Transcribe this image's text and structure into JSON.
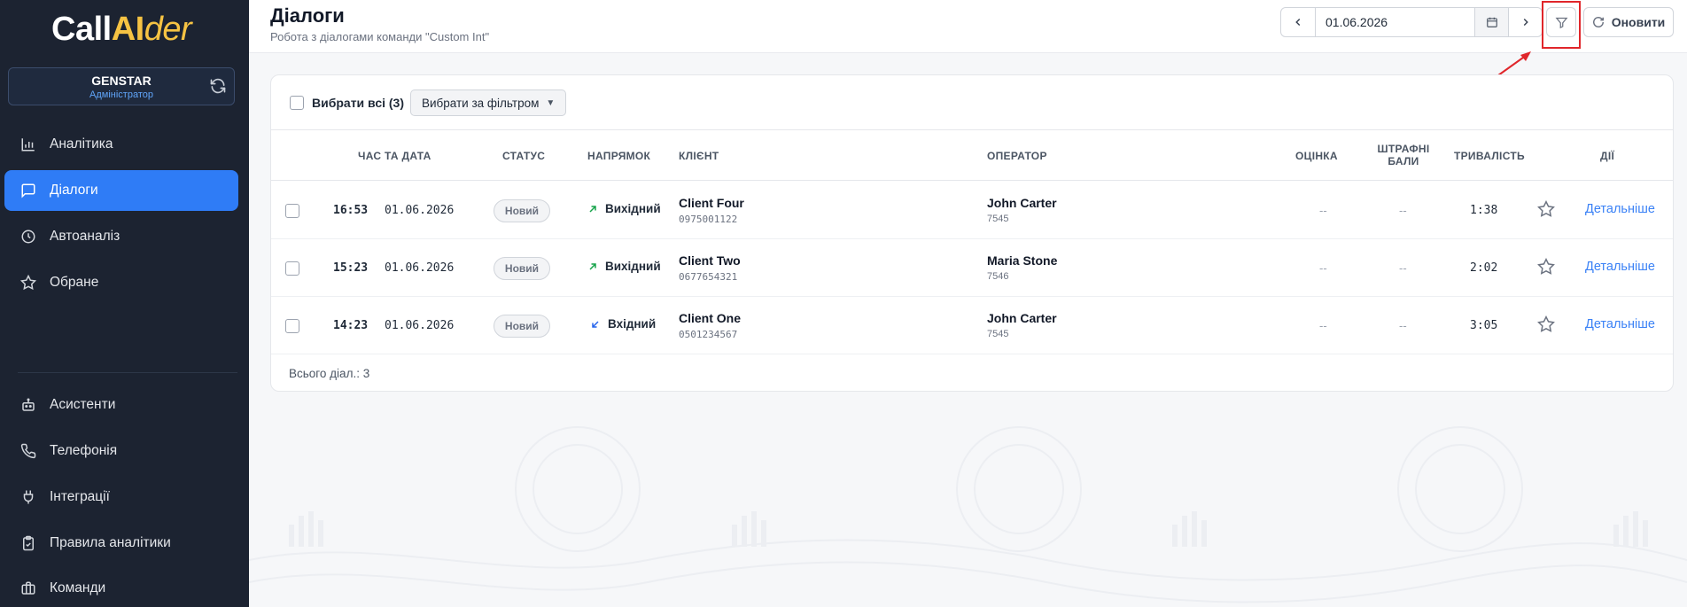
{
  "app": {
    "logo_call": "Call",
    "logo_ai": "AI",
    "logo_der": "der"
  },
  "account": {
    "name": "GENSTAR",
    "role": "Адміністратор"
  },
  "sidebar": {
    "items": [
      {
        "label": "Аналітика",
        "icon": "bar-chart-icon"
      },
      {
        "label": "Діалоги",
        "icon": "chat-icon"
      },
      {
        "label": "Автоаналіз",
        "icon": "clock-icon"
      },
      {
        "label": "Обране",
        "icon": "star-icon"
      },
      {
        "label": "Асистенти",
        "icon": "robot-icon"
      },
      {
        "label": "Телефонія",
        "icon": "phone-icon"
      },
      {
        "label": "Інтеграції",
        "icon": "plug-icon"
      },
      {
        "label": "Правила аналітики",
        "icon": "clipboard-check-icon"
      },
      {
        "label": "Команди",
        "icon": "briefcase-icon"
      }
    ]
  },
  "header": {
    "title": "Діалоги",
    "subtitle": "Робота з діалогами команди \"Custom Int\"",
    "date": "01.06.2026",
    "refresh_label": "Оновити"
  },
  "toolbar": {
    "select_all_label": "Вибрати всі (3)",
    "filter_select_label": "Вибрати за фільтром"
  },
  "table": {
    "columns": {
      "time_date": "ЧАС ТА ДАТА",
      "status": "СТАТУС",
      "direction": "НАПРЯМОК",
      "client": "КЛІЄНТ",
      "operator": "ОПЕРАТОР",
      "score": "ОЦІНКА",
      "penalty": "ШТРАФНІ БАЛИ",
      "duration": "ТРИВАЛІСТЬ",
      "actions": "ДІЇ"
    },
    "rows": [
      {
        "time": "16:53",
        "date": "01.06.2026",
        "status": "Новий",
        "direction": "Вихідний",
        "direction_type": "outgoing",
        "client_name": "Client Four",
        "client_phone": "0975001122",
        "operator_name": "John Carter",
        "operator_id": "7545",
        "score": "--",
        "penalty": "--",
        "duration": "1:38",
        "action": "Детальніше"
      },
      {
        "time": "15:23",
        "date": "01.06.2026",
        "status": "Новий",
        "direction": "Вихідний",
        "direction_type": "outgoing",
        "client_name": "Client Two",
        "client_phone": "0677654321",
        "operator_name": "Maria Stone",
        "operator_id": "7546",
        "score": "--",
        "penalty": "--",
        "duration": "2:02",
        "action": "Детальніше"
      },
      {
        "time": "14:23",
        "date": "01.06.2026",
        "status": "Новий",
        "direction": "Вхідний",
        "direction_type": "incoming",
        "client_name": "Client One",
        "client_phone": "0501234567",
        "operator_name": "John Carter",
        "operator_id": "7545",
        "score": "--",
        "penalty": "--",
        "duration": "3:05",
        "action": "Детальніше"
      }
    ],
    "total_label": "Всього діал.: 3"
  },
  "colors": {
    "sidebar_bg": "#1c2331",
    "accent": "#2f7cf6",
    "logo_accent": "#f6c343",
    "link": "#3b82f6",
    "highlight": "#e0262b",
    "outgoing_arrow": "#16a34a",
    "incoming_arrow": "#2563eb"
  }
}
